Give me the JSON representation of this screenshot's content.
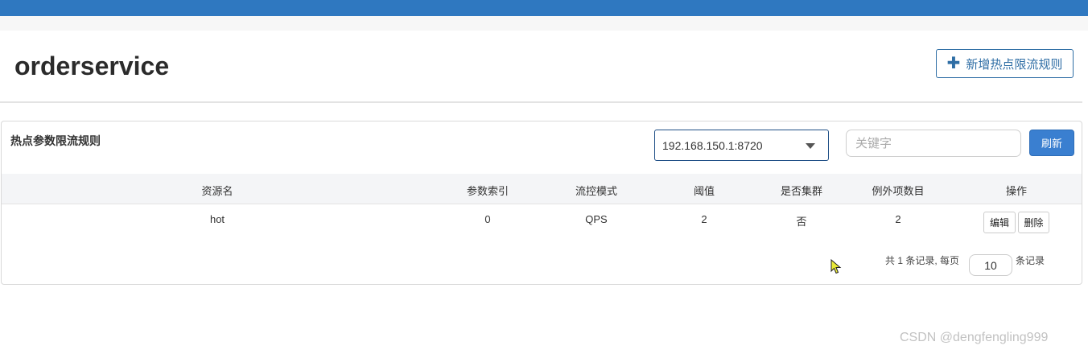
{
  "header": {
    "title": "orderservice",
    "add_rule_label": "新增热点限流规则",
    "add_icon": "plus-icon"
  },
  "panel": {
    "title": "热点参数限流规则",
    "machine_select": {
      "selected": "192.168.150.1:8720",
      "icon": "caret-down-icon"
    },
    "search": {
      "placeholder": "关键字",
      "value": ""
    },
    "refresh_label": "刷新"
  },
  "table": {
    "columns": [
      "资源名",
      "参数索引",
      "流控模式",
      "阈值",
      "是否集群",
      "例外项数目",
      "操作"
    ],
    "rows": [
      {
        "resource": "hot",
        "param_index": "0",
        "mode": "QPS",
        "threshold": "2",
        "cluster": "否",
        "exception_count": "2",
        "edit_label": "编辑",
        "delete_label": "删除"
      }
    ]
  },
  "pagination": {
    "summary": "共 1 条记录, 每页",
    "page_size": "10",
    "suffix": "条记录"
  },
  "watermark": "CSDN @dengfengling999",
  "colors": {
    "topbar": "#2f78c0",
    "primary_button": "#3a7fd0",
    "accent_text": "#2f6ea5"
  }
}
